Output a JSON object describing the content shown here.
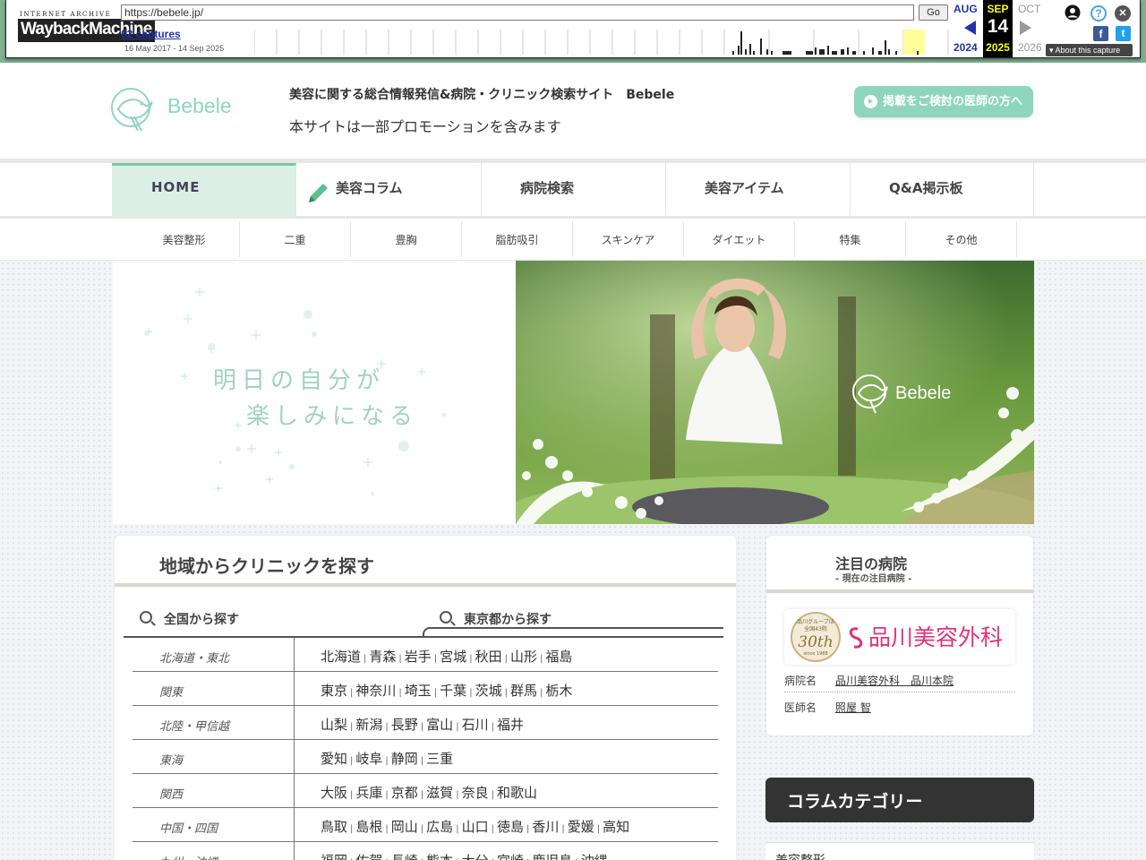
{
  "wayback": {
    "ia_label": "INTERNET ARCHIVE",
    "logo_text": "WaybackMachine",
    "url": "https://bebele.jp/",
    "go_label": "Go",
    "captures": "62 captures",
    "range": "16 May 2017 - 14 Sep 2025",
    "prev_month": "AUG",
    "prev_year": "2024",
    "cur_month": "SEP",
    "cur_day": "14",
    "cur_year": "2025",
    "next_month": "OCT",
    "next_year": "2026",
    "about": "About this capture",
    "help_glyph": "?",
    "close_glyph": "✕",
    "fb_glyph": "f",
    "tw_glyph": "t"
  },
  "header": {
    "logo_text": "Bebele",
    "tagline": "美容に関する総合情報発信&病院・クリニック検索サイト　Bebele",
    "promo": "本サイトは一部プロモーションを含みます",
    "doctor_button": "掲載をご検討の医師の方へ"
  },
  "nav": {
    "items": [
      "HOME",
      "美容コラム",
      "病院検索",
      "美容アイテム",
      "Q&A掲示板"
    ]
  },
  "subnav": {
    "items": [
      "美容整形",
      "二重",
      "豊胸",
      "脂肪吸引",
      "スキンケア",
      "ダイエット",
      "特集",
      "その他"
    ]
  },
  "hero": {
    "line1": "明日の自分が",
    "line2": "楽しみになる",
    "photo_logo": "Bebele"
  },
  "search": {
    "title": "地域からクリニックを探す",
    "tab_national": "全国から探す",
    "tab_tokyo": "東京都から探す",
    "regions": [
      {
        "name": "北海道・東北",
        "prefs": [
          "北海道",
          "青森",
          "岩手",
          "宮城",
          "秋田",
          "山形",
          "福島"
        ]
      },
      {
        "name": "関東",
        "prefs": [
          "東京",
          "神奈川",
          "埼玉",
          "千葉",
          "茨城",
          "群馬",
          "栃木"
        ]
      },
      {
        "name": "北陸・甲信越",
        "prefs": [
          "山梨",
          "新潟",
          "長野",
          "富山",
          "石川",
          "福井"
        ]
      },
      {
        "name": "東海",
        "prefs": [
          "愛知",
          "岐阜",
          "静岡",
          "三重"
        ]
      },
      {
        "name": "関西",
        "prefs": [
          "大阪",
          "兵庫",
          "京都",
          "滋賀",
          "奈良",
          "和歌山"
        ]
      },
      {
        "name": "中国・四国",
        "prefs": [
          "鳥取",
          "島根",
          "岡山",
          "広島",
          "山口",
          "徳島",
          "香川",
          "愛媛",
          "高知"
        ]
      },
      {
        "name": "九州・沖縄",
        "prefs": [
          "福岡",
          "佐賀",
          "長崎",
          "熊本",
          "大分",
          "宮崎",
          "鹿児島",
          "沖縄"
        ]
      }
    ]
  },
  "featured": {
    "title": "注目の病院",
    "subtitle": "- 現在の注目病院 -",
    "banner_name": "品川美容外科",
    "banner_badge_top": "品川グループは",
    "banner_badge_mid": "全国43院",
    "banner_badge_num": "30th",
    "banner_badge_since": "since 1988",
    "hospital_label": "病院名",
    "hospital_value": "品川美容外科　品川本院",
    "doctor_label": "医師名",
    "doctor_value": "照屋 智"
  },
  "column_category": {
    "title": "コラムカテゴリー",
    "first_item": "美容整形"
  },
  "colors": {
    "brand_green": "#8dd6bd",
    "nav_active_bg": "#dcefe6",
    "wayback_blue": "#2233aa",
    "shinagawa_pink": "#e0327a"
  }
}
